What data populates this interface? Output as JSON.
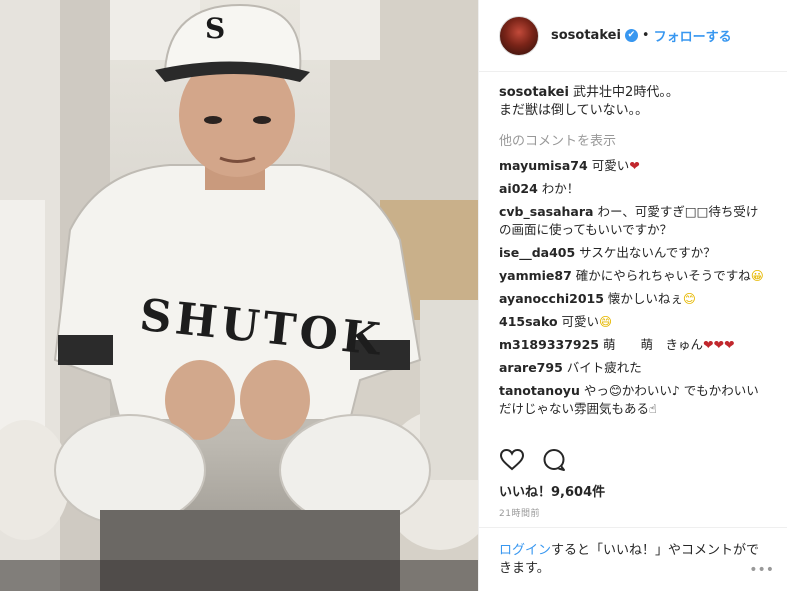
{
  "header": {
    "username": "sosotakei",
    "verified_icon": "✔",
    "dot": "•",
    "follow_label": "フォローする"
  },
  "caption": {
    "user": "sosotakei",
    "text": "武井壮中2時代。。\nまだ獣は倒していない。。"
  },
  "more_comments": "他のコメントを表示",
  "comments": [
    {
      "user": "mayumisa74",
      "text": "可愛い",
      "emoji": "❤",
      "emoji_type": "heart"
    },
    {
      "user": "ai024",
      "text": "わか！",
      "emoji": "",
      "emoji_type": ""
    },
    {
      "user": "cvb_sasahara",
      "text": "わー、可愛すぎ□□待ち受けの画面に使ってもいいですか？",
      "emoji": "",
      "emoji_type": ""
    },
    {
      "user": "ise__da405",
      "text": "サスケ出ないんですか？",
      "emoji": "",
      "emoji_type": ""
    },
    {
      "user": "yammie87",
      "text": "確かにやられちゃいそうですね",
      "emoji": "😀",
      "emoji_type": "face"
    },
    {
      "user": "ayanocchi2015",
      "text": "懐かしいねぇ",
      "emoji": "😊",
      "emoji_type": "face"
    },
    {
      "user": "415sako",
      "text": "可愛い",
      "emoji": "😄",
      "emoji_type": "face"
    },
    {
      "user": "m3189337925",
      "text": "萌　　萌　きゅん",
      "emoji": "❤❤❤",
      "emoji_type": "heart"
    },
    {
      "user": "arare795",
      "text": "バイト疲れた",
      "emoji": "",
      "emoji_type": ""
    },
    {
      "user": "tanotanoyu",
      "text": "やっ😊かわいい♪ でもかわいいだけじゃない雰囲気もある☝",
      "emoji": "",
      "emoji_type": ""
    }
  ],
  "likes": "いいね！9,604件",
  "timestamp": "21時間前",
  "footer": {
    "login_label": "ログイン",
    "rest_text": "すると「いいね！」やコメントができます。",
    "options_icon": "•••"
  },
  "icons": {
    "like": "heart-outline-icon",
    "comment": "comment-bubble-icon",
    "options": "more-options-icon"
  },
  "colors": {
    "accent": "#3897f0",
    "heart": "#c1272d"
  },
  "photo": {
    "jersey_text": "SHUTOK",
    "cap_letter": "S"
  }
}
